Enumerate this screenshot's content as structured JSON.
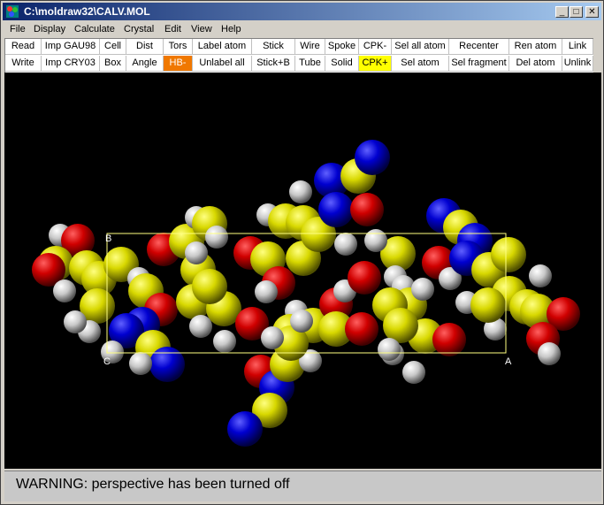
{
  "window": {
    "title": "C:\\moldraw32\\CALV.MOL",
    "minimize_glyph": "_",
    "maximize_glyph": "□",
    "close_glyph": "✕"
  },
  "menu": [
    "File",
    "Display",
    "Calculate",
    "Crystal",
    "Edit",
    "View",
    "Help"
  ],
  "toolbar": {
    "row1": [
      "Read",
      "Imp GAU98",
      "Cell",
      "Dist",
      "Tors",
      "Label atom",
      "Stick",
      "Wire",
      "Spoke",
      "CPK-",
      "Sel all atom",
      "Recenter",
      "Ren atom",
      "Link"
    ],
    "row2": [
      "Write",
      "Imp CRY03",
      "Box",
      "Angle",
      "HB-",
      "Unlabel all",
      "Stick+B",
      "Tube",
      "Solid",
      "CPK+",
      "Sel atom",
      "Sel fragment",
      "Del atom",
      "Unlink"
    ],
    "highlight_orange": "HB-",
    "highlight_yellow": "CPK+"
  },
  "viewer": {
    "background": "#000000",
    "cell_color": "#ffff80",
    "cell_labels": {
      "b": "B",
      "c": "C",
      "a": "A"
    },
    "atom_colors": {
      "carbon": "#c8c800",
      "hydrogen": "#c8c8c8",
      "oxygen": "#cc0000",
      "nitrogen": "#0000cc"
    }
  },
  "status": {
    "message": "WARNING: perspective has been turned off"
  }
}
